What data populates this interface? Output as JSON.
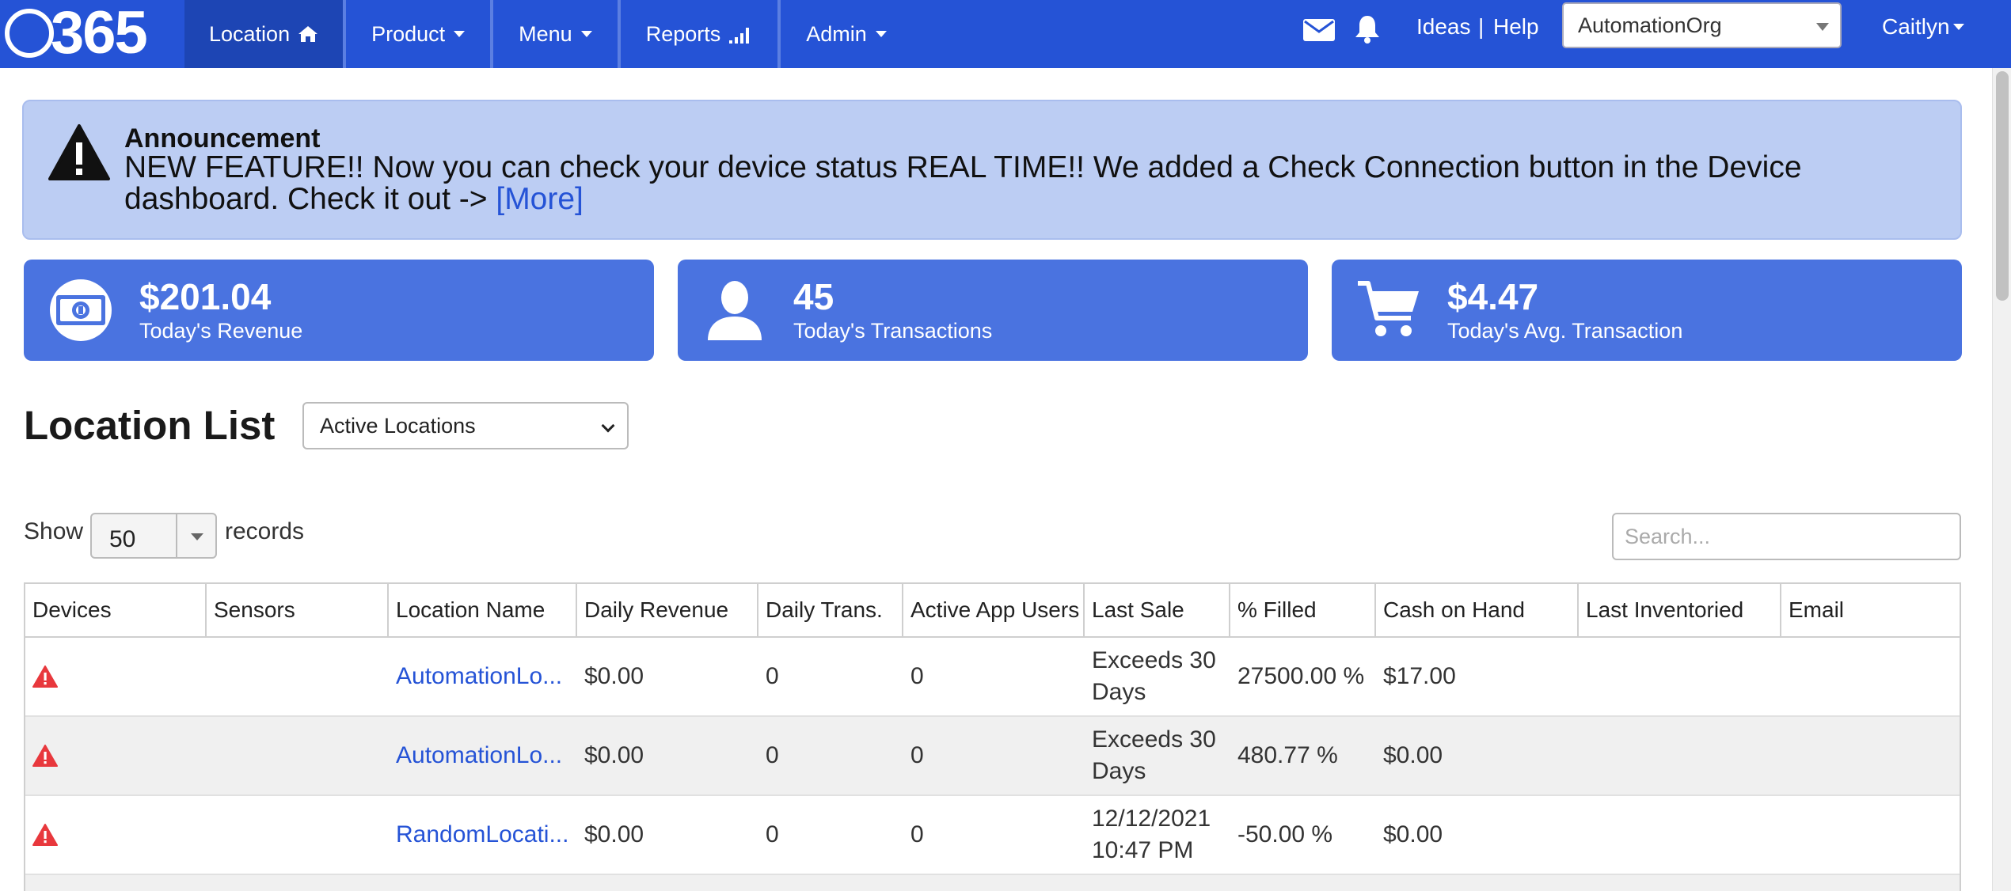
{
  "brand": {
    "logo_text": "365"
  },
  "nav": {
    "items": [
      {
        "label": "Location",
        "icon": "home-icon",
        "active": true
      },
      {
        "label": "Product",
        "dropdown": true
      },
      {
        "label": "Menu",
        "dropdown": true
      },
      {
        "label": "Reports",
        "icon": "signal-bars-icon"
      },
      {
        "label": "Admin",
        "dropdown": true
      }
    ],
    "ideas": "Ideas",
    "separator": "|",
    "help": "Help",
    "org_selected": "AutomationOrg",
    "user": "Caitlyn"
  },
  "announcement": {
    "title": "Announcement",
    "body": "NEW FEATURE!! Now you can check your device status REAL TIME!! We added a Check Connection button in the Device dashboard. Check it out -> ",
    "more": "[More]"
  },
  "stats": [
    {
      "icon": "money-icon",
      "value": "$201.04",
      "label": "Today's Revenue"
    },
    {
      "icon": "user-icon",
      "value": "45",
      "label": "Today's Transactions"
    },
    {
      "icon": "cart-icon",
      "value": "$4.47",
      "label": "Today's Avg. Transaction"
    }
  ],
  "location_list": {
    "title": "Location List",
    "filter_selected": "Active Locations",
    "show_label": "Show",
    "page_length": "50",
    "records_label": "records",
    "search_placeholder": "Search..."
  },
  "table": {
    "columns": [
      "Devices",
      "Sensors",
      "Location Name",
      "Daily Revenue",
      "Daily Trans.",
      "Active App Users",
      "Last Sale",
      "% Filled",
      "Cash on Hand",
      "Last Inventoried",
      "Email"
    ],
    "rows": [
      {
        "location": "AutomationLo...",
        "daily_revenue": "$0.00",
        "daily_trans": "0",
        "active_app_users": "0",
        "last_sale": "Exceeds 30 Days",
        "filled": "27500.00 %",
        "cash": "$17.00",
        "inventoried": "",
        "email": ""
      },
      {
        "location": "AutomationLo...",
        "daily_revenue": "$0.00",
        "daily_trans": "0",
        "active_app_users": "0",
        "last_sale": "Exceeds 30 Days",
        "filled": "480.77 %",
        "cash": "$0.00",
        "inventoried": "",
        "email": ""
      },
      {
        "location": "RandomLocati...",
        "daily_revenue": "$0.00",
        "daily_trans": "0",
        "active_app_users": "0",
        "last_sale": "12/12/2021 10:47 PM",
        "filled": "-50.00 %",
        "cash": "$0.00",
        "inventoried": "",
        "email": ""
      }
    ]
  },
  "colors": {
    "nav_bg": "#2553d6",
    "nav_active": "#1d45b4",
    "card_bg": "#4a73e0",
    "announce_bg": "#bccdf3",
    "link": "#2553d6",
    "warning": "#e8383d"
  }
}
